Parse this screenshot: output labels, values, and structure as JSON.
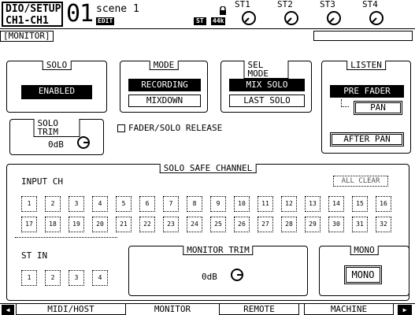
{
  "header": {
    "function_name": "DIO/SETUP",
    "page_name": "CH1-CH1",
    "scene_number": "01",
    "scene_label": "scene 1",
    "edit_badge": "EDIT",
    "st_badge": "ST",
    "fs_badge": "44k",
    "st_channels": [
      "ST1",
      "ST2",
      "ST3",
      "ST4"
    ]
  },
  "section_label": "MONITOR",
  "solo": {
    "title": "SOLO",
    "state": "ENABLED"
  },
  "mode": {
    "title": "MODE",
    "recording": "RECORDING",
    "mixdown": "MIXDOWN"
  },
  "sel_mode": {
    "title": "SEL MODE",
    "mix_solo": "MIX SOLO",
    "last_solo": "LAST SOLO"
  },
  "listen": {
    "title": "LISTEN",
    "pre_fader": "PRE FADER",
    "pan": "PAN",
    "after_pan": "AFTER PAN"
  },
  "solo_trim": {
    "title": "SOLO TRIM",
    "value": "0dB"
  },
  "fader_solo_release": {
    "label": "FADER/SOLO RELEASE",
    "checked": false
  },
  "solo_safe": {
    "title": "SOLO SAFE CHANNEL",
    "input_label": "INPUT CH",
    "all_clear": "ALL CLEAR",
    "input_channels": [
      "1",
      "2",
      "3",
      "4",
      "5",
      "6",
      "7",
      "8",
      "9",
      "10",
      "11",
      "12",
      "13",
      "14",
      "15",
      "16",
      "17",
      "18",
      "19",
      "20",
      "21",
      "22",
      "23",
      "24",
      "25",
      "26",
      "27",
      "28",
      "29",
      "30",
      "31",
      "32"
    ],
    "st_in_label": "ST IN",
    "st_in_channels": [
      "1",
      "2",
      "3",
      "4"
    ]
  },
  "monitor_trim": {
    "title": "MONITOR TRIM",
    "value": "0dB"
  },
  "mono": {
    "title": "MONO",
    "button": "MONO"
  },
  "tabs": [
    "MIDI/HOST",
    "MONITOR",
    "REMOTE",
    "MACHINE"
  ],
  "active_tab": "MONITOR"
}
